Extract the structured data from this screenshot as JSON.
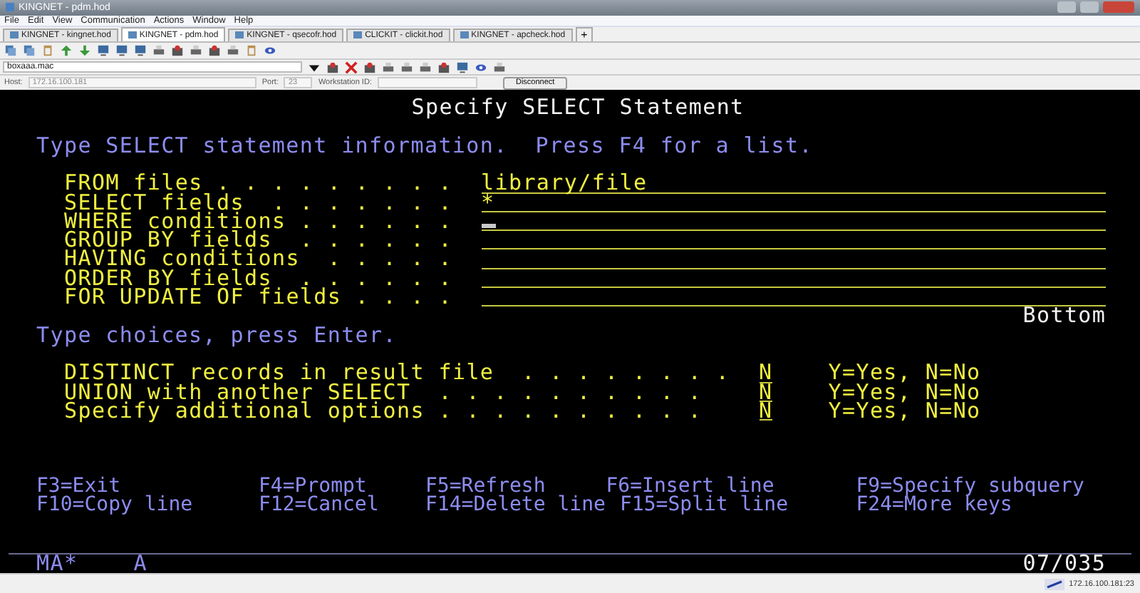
{
  "window": {
    "title": "KINGNET - pdm.hod"
  },
  "menu": [
    "File",
    "Edit",
    "View",
    "Communication",
    "Actions",
    "Window",
    "Help"
  ],
  "tabs": [
    {
      "label": "KINGNET - kingnet.hod",
      "selected": false
    },
    {
      "label": "KINGNET - pdm.hod",
      "selected": true
    },
    {
      "label": "KINGNET - qsecofr.hod",
      "selected": false
    },
    {
      "label": "CLICKIT - clickit.hod",
      "selected": false
    },
    {
      "label": "KINGNET - apcheck.hod",
      "selected": false
    }
  ],
  "new_tab": "+",
  "macro": {
    "value": "boxaaa.mac"
  },
  "connection": {
    "host_label": "Host:",
    "host": "172.16.100.181",
    "port_label": "Port:",
    "port": "23",
    "workstation_label": "Workstation ID:",
    "button": "Disconnect"
  },
  "screen": {
    "title": "Specify SELECT Statement",
    "instruction": "Type SELECT statement information.  Press F4 for a list.",
    "fields": [
      {
        "label": "FROM files . . . . . . . . .",
        "value": "library/file",
        "cursor": false
      },
      {
        "label": "SELECT fields  . . . . . . .",
        "value": "*",
        "cursor": false
      },
      {
        "label": "WHERE conditions . . . . . .",
        "cursor": true
      },
      {
        "label": "GROUP BY fields  . . . . . .",
        "cursor": false
      },
      {
        "label": "HAVING conditions  . . . . .",
        "cursor": false
      },
      {
        "label": "ORDER BY fields  . . . . . .",
        "cursor": false
      },
      {
        "label": "FOR UPDATE OF fields . . . .",
        "cursor": false
      }
    ],
    "position": "Bottom",
    "choices_prompt": "Type choices, press Enter.",
    "choices": [
      {
        "label": "DISTINCT records in result file  . . . . . . . .",
        "value": "N",
        "hint": "Y=Yes, N=No"
      },
      {
        "label": "UNION with another SELECT  . . . . . . . . . .",
        "value": "N",
        "hint": "Y=Yes, N=No"
      },
      {
        "label": "Specify additional options . . . . . . . . . .",
        "value": "N",
        "hint": "Y=Yes, N=No"
      }
    ],
    "function_keys": [
      [
        "F3=Exit",
        "F4=Prompt",
        "F5=Refresh",
        "F6=Insert line",
        "F9=Specify subquery"
      ],
      [
        "F10=Copy line",
        "F12=Cancel",
        "F14=Delete line",
        "F15=Split line",
        "F24=More keys"
      ]
    ],
    "operator_info": {
      "mode": "MA*",
      "indicator": "A",
      "cursor_position": "07/035"
    }
  },
  "status_bar": {
    "address": "172.16.100.181:23"
  }
}
